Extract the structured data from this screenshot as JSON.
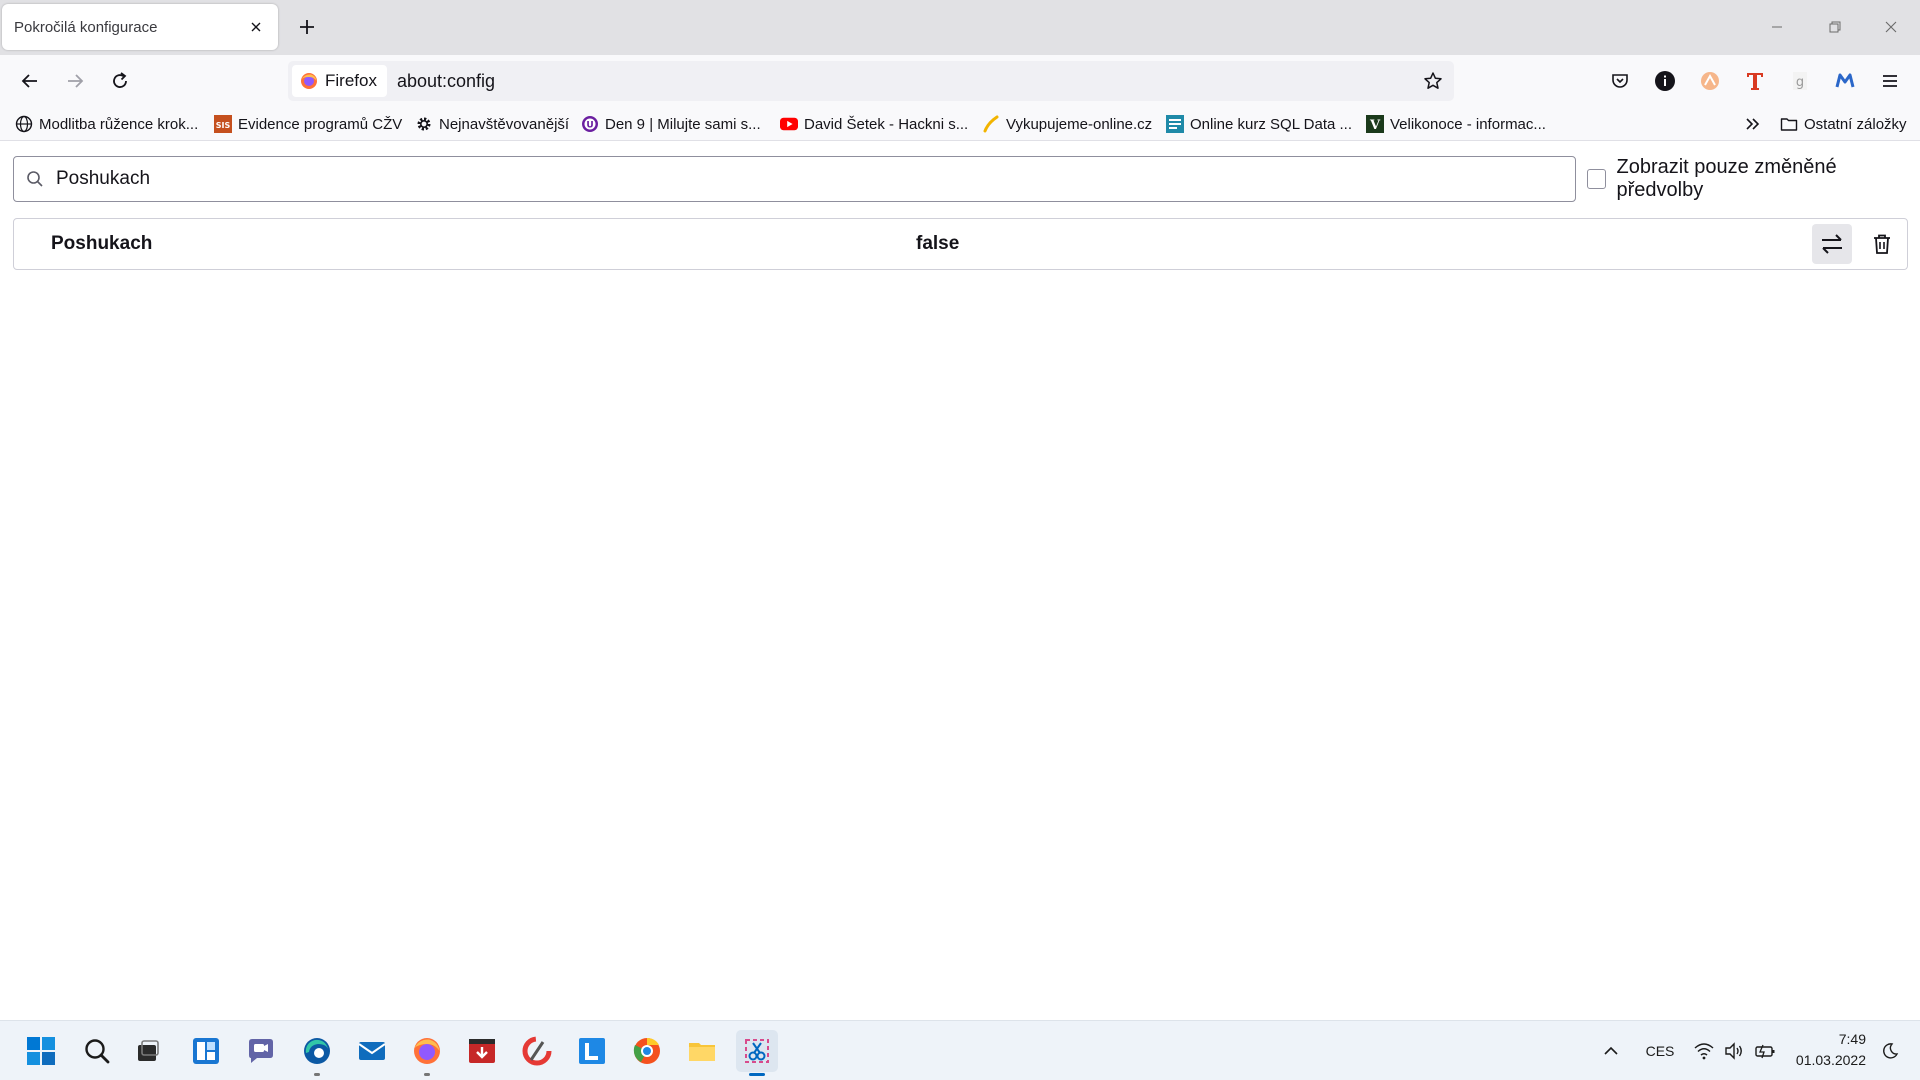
{
  "browser": {
    "tab": {
      "title": "Pokročilá konfigurace"
    },
    "identity_label": "Firefox",
    "url": "about:config"
  },
  "bookmarks": [
    {
      "label": "Modlitba růžence krok...",
      "icon": "globe-icon"
    },
    {
      "label": "Evidence programů CŽV",
      "icon": "sis-icon"
    },
    {
      "label": "Nejnavštěvovanější",
      "icon": "gear-icon"
    },
    {
      "label": "Den 9 | Milujte sami s...",
      "icon": "u-circle-icon"
    },
    {
      "label": "David Šetek - Hackni s...",
      "icon": "youtube-icon"
    },
    {
      "label": "Vykupujeme-online.cz",
      "icon": "pen-icon"
    },
    {
      "label": "Online kurz SQL Data ...",
      "icon": "course-icon"
    },
    {
      "label": "Velikonoce - informac...",
      "icon": "v-icon"
    }
  ],
  "bookmarks_other": "Ostatní záložky",
  "config": {
    "search_value": "Poshukach",
    "changed_only_label": "Zobrazit pouze změněné předvolby",
    "changed_only_checked": false,
    "rows": [
      {
        "name": "Poshukach",
        "value": "false"
      }
    ]
  },
  "taskbar": {
    "language": "CES",
    "time": "7:49",
    "date": "01.03.2022"
  },
  "colors": {
    "tabstrip": "#e1e1e4",
    "toolbar": "#f9f9fb",
    "urlbar": "#f0f0f4",
    "taskbar": "#eef3f9",
    "accent": "#0067c0"
  }
}
